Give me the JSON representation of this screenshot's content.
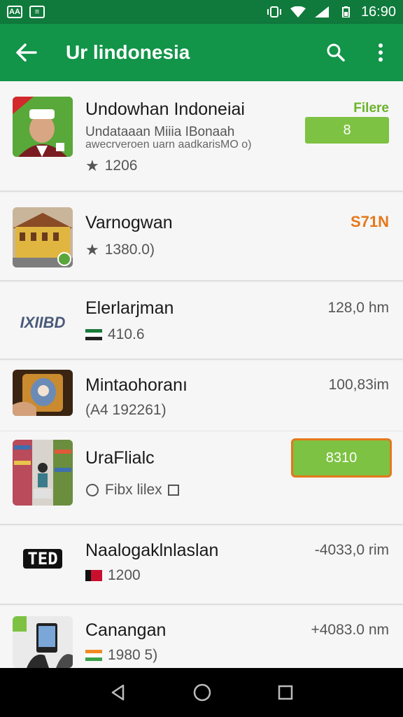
{
  "status_bar": {
    "time": "16:90",
    "left_icons": [
      "AA",
      "≡"
    ],
    "icons": [
      "vibrate-icon",
      "wifi-icon",
      "signal-icon",
      "battery-icon"
    ]
  },
  "app_bar": {
    "title": "Ur lindonesia",
    "icons": [
      "back-arrow-icon",
      "search-icon",
      "more-vert-icon"
    ]
  },
  "items": [
    {
      "title": "Undowhan Indoneiai",
      "subtitle": "Undataaan Miiia IBonaah",
      "subtitle2": "awecrveroen uarn aadkarisMO o)",
      "meta": "1206",
      "meta_icon": "star-icon",
      "filter_label": "Filere",
      "button_label": "8"
    },
    {
      "title": "Varnogwan",
      "meta": "1380.0)",
      "meta_icon": "star-icon",
      "price": "S71N"
    },
    {
      "title": "Elerlarjman",
      "meta": "410.6",
      "meta_icon": "flag-icon",
      "right_text": "128,0 hm",
      "logo_text": "IXIIBD"
    },
    {
      "title": "Mintaohoranı",
      "meta": "(A4 192261)",
      "right_text": "100,83im"
    },
    {
      "title": "UraFlialc",
      "meta": "Fibx lilex",
      "meta_icon": "radio-icon",
      "button_label": "8310"
    },
    {
      "title": "Naalogaklnlaslan",
      "meta": "1200",
      "meta_icon": "flag-icon",
      "right_text": "-4033,0 rim",
      "logo_text": "TED"
    },
    {
      "title": "Canangan",
      "meta": "1980 5)",
      "meta_icon": "flag-icon",
      "right_text": "+4083.0 nm"
    }
  ],
  "colors": {
    "status_bar": "#0f7a3c",
    "app_bar": "#129449",
    "accent_green": "#7dc242",
    "price_orange": "#e5781b",
    "highlight_border": "#e5781b"
  },
  "nav_bar": {
    "icons": [
      "back-triangle-icon",
      "home-circle-icon",
      "recents-square-icon"
    ]
  }
}
